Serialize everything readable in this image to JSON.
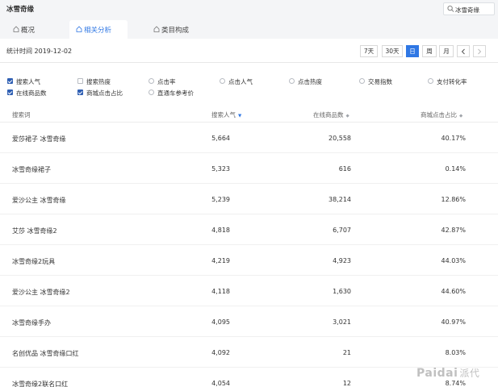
{
  "app": {
    "title": "冰雪奇缘"
  },
  "search": {
    "value": "冰雪奇缘"
  },
  "tabs": [
    {
      "label": "概况",
      "active": false
    },
    {
      "label": "相关分析",
      "active": true
    },
    {
      "label": "类目构成",
      "active": false
    }
  ],
  "stat_time": "统计时间 2019-12-02",
  "period_buttons": {
    "seven_day": "7天",
    "thirty_day": "30天",
    "day": "日",
    "week": "周",
    "month": "月"
  },
  "metrics": [
    {
      "label": "搜索人气",
      "checked": true
    },
    {
      "label": "搜索热度",
      "checked": false
    },
    {
      "label": "点击率",
      "checked": false
    },
    {
      "label": "点击人气",
      "checked": false
    },
    {
      "label": "点击热度",
      "checked": false
    },
    {
      "label": "交易指数",
      "checked": false
    },
    {
      "label": "支付转化率",
      "checked": false
    },
    {
      "label": "在线商品数",
      "checked": true
    },
    {
      "label": "商城点击占比",
      "checked": true
    },
    {
      "label": "直通车参考价",
      "checked": false
    }
  ],
  "table": {
    "headers": {
      "keyword": "搜索词",
      "popularity": "搜索人气",
      "online_items": "在线商品数",
      "mall_click_ratio": "商城点击占比"
    },
    "rows": [
      {
        "keyword": "爱莎裙子 冰雪奇缘",
        "popularity": "5,664",
        "online_items": "20,558",
        "mall_click_ratio": "40.17%"
      },
      {
        "keyword": "冰雪奇缘裙子",
        "popularity": "5,323",
        "online_items": "616",
        "mall_click_ratio": "0.14%"
      },
      {
        "keyword": "爱沙公主 冰雪奇缘",
        "popularity": "5,239",
        "online_items": "38,214",
        "mall_click_ratio": "12.86%"
      },
      {
        "keyword": "艾莎 冰雪奇缘2",
        "popularity": "4,818",
        "online_items": "6,707",
        "mall_click_ratio": "42.87%"
      },
      {
        "keyword": "冰雪奇缘2玩具",
        "popularity": "4,219",
        "online_items": "4,923",
        "mall_click_ratio": "44.03%"
      },
      {
        "keyword": "爱沙公主 冰雪奇缘2",
        "popularity": "4,118",
        "online_items": "1,630",
        "mall_click_ratio": "44.60%"
      },
      {
        "keyword": "冰雪奇缘手办",
        "popularity": "4,095",
        "online_items": "3,021",
        "mall_click_ratio": "40.97%"
      },
      {
        "keyword": "名创优品 冰雪奇缘口红",
        "popularity": "4,092",
        "online_items": "21",
        "mall_click_ratio": "8.03%"
      },
      {
        "keyword": "冰雪奇缘2联名口红",
        "popularity": "4,054",
        "online_items": "12",
        "mall_click_ratio": "8.74%"
      }
    ]
  },
  "watermark": {
    "latin": "Paidai",
    "cn": "派代"
  },
  "colors": {
    "accent": "#2f77e4",
    "checkbox_checked": "#2f5fb3",
    "header_bg": "#f4f5f7"
  }
}
